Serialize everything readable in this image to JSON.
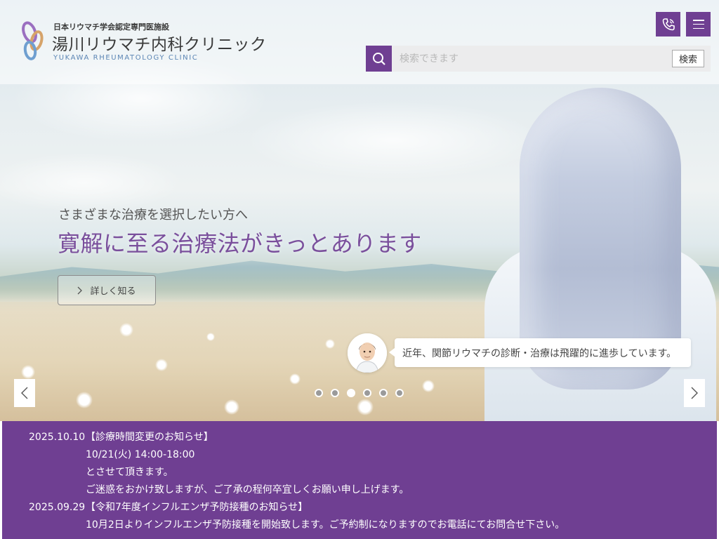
{
  "header": {
    "logo_sub": "日本リウマチ学会認定専門医施設",
    "logo_title": "湯川リウマチ内科クリニック",
    "logo_en": "YUKAWA RHEUMATOLOGY CLINIC",
    "search_placeholder": "検索できます",
    "search_button": "検索"
  },
  "hero": {
    "subtitle": "さまざまな治療を選択したい方へ",
    "title": "寛解に至る治療法がきっとあります",
    "more_button": "詳しく知る",
    "speech": "近年、関節リウマチの診断・治療は飛躍的に進歩しています。",
    "slide_count": 6,
    "active_slide": 2
  },
  "news": [
    {
      "date": "2025.10.10",
      "lines": [
        "【診療時間変更のお知らせ】",
        "10/21(火) 14:00-18:00",
        "とさせて頂きます。",
        "ご迷惑をおかけ致しますが、ご了承の程何卒宜しくお願い申し上げます。"
      ]
    },
    {
      "date": "2025.09.29",
      "lines": [
        "【令和7年度インフルエンザ予防接種のお知らせ】",
        "10月2日よりインフルエンザ予防接種を開始致します。ご予約制になりますのでお電話にてお問合せ下さい。"
      ]
    }
  ],
  "colors": {
    "brand_purple": "#6f3f92",
    "title_purple": "#7a4f9c",
    "logo_blue": "#5c86b5"
  },
  "icons": [
    "logo-mark-icon",
    "phone-icon",
    "hamburger-menu-icon",
    "search-icon",
    "chevron-right-icon",
    "chevron-left-icon",
    "doctor-avatar-icon"
  ]
}
